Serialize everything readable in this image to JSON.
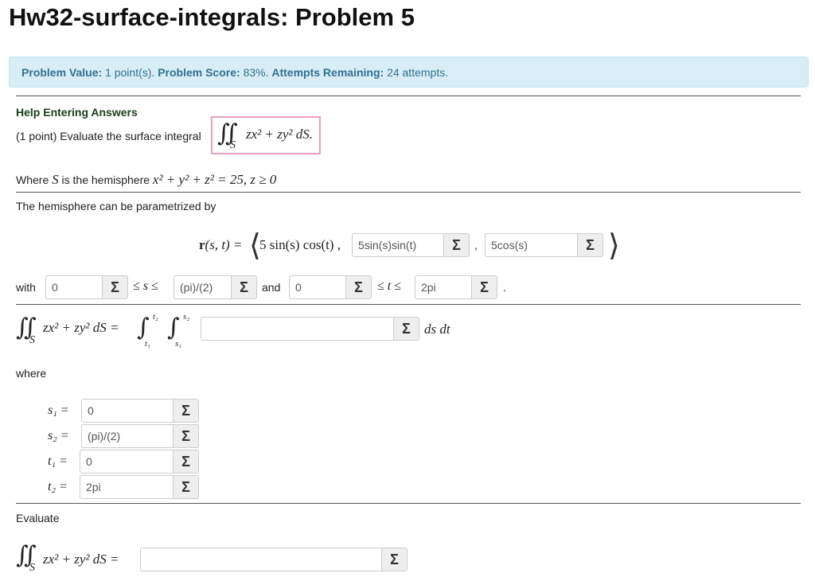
{
  "title": "Hw32-surface-integrals: Problem 5",
  "info": {
    "value_label": "Problem Value:",
    "value": "1 point(s).",
    "score_label": "Problem Score:",
    "score": "83%.",
    "attempts_label": "Attempts Remaining:",
    "attempts": "24 attempts."
  },
  "help_link": "Help Entering Answers",
  "problem": {
    "intro": "(1 point) Evaluate the surface integral",
    "integral_expr": "zx² + zy² dS.",
    "integral_sub": "S",
    "where_prefix": "Where",
    "where_var": "S",
    "where_suffix": "is the hemisphere",
    "hemisphere_eq": "x² + y² + z² = 25,  z ≥ 0",
    "param_text": "The hemisphere can be parametrized by",
    "r_label": "r",
    "r_args": "(s, t) =",
    "first_component": "5 sin(s) cos(t) ,",
    "comma": ",",
    "with_label": "with",
    "and_label": "and",
    "period": ".",
    "leq_s": "≤ s ≤",
    "leq_t": "≤ t ≤",
    "iterated_lhs": "zx² + zy² dS =",
    "upper_t": "t₂",
    "lower_t": "t₁",
    "upper_s": "s₂",
    "lower_s": "s₁",
    "ds_dt": "ds dt",
    "where_label": "where",
    "s1_label": "s₁ =",
    "s2_label": "s₂ =",
    "t1_label": "t₁ =",
    "t2_label": "t₂ =",
    "evaluate_label": "Evaluate",
    "final_lhs": "zx² + zy² dS ="
  },
  "inputs": {
    "y_component": "5sin(s)sin(t)",
    "z_component": "5cos(s)",
    "s_lower": "0",
    "s_upper": "(pi)/(2)",
    "t_lower": "0",
    "t_upper": "2pi",
    "integrand": "",
    "s1": "0",
    "s2": "(pi)/(2)",
    "t1": "0",
    "t2": "2pi",
    "final_answer": ""
  },
  "sigma": "Σ",
  "colors": {
    "info_bg": "#d9edf7",
    "info_text": "#31708f",
    "highlight_border": "#e8a0c0",
    "help_link": "#1a3d1a"
  }
}
